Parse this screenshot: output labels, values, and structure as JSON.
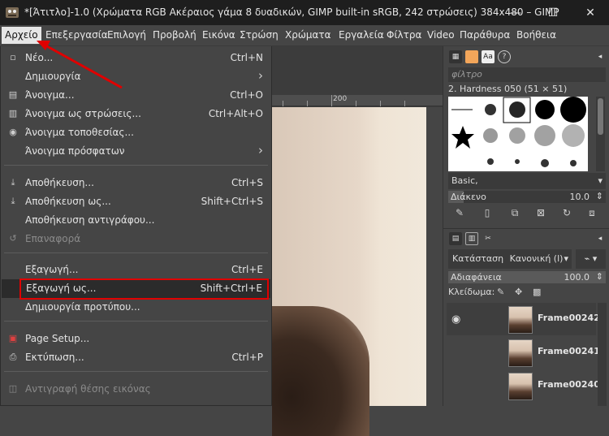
{
  "window": {
    "title": "*[Άτιτλο]-1.0 (Χρώματα RGB Ακέραιος γάμα 8 δυαδικών, GIMP built-in sRGB, 242 στρώσεις) 384x480 – GIMP",
    "minimize_glyph": "—",
    "maximize_glyph": "☐",
    "close_glyph": "✕"
  },
  "menubar": [
    "Αρχείο",
    "Επεξεργασία",
    "Επιλογή",
    "Προβολή",
    "Εικόνα",
    "Στρώση",
    "Χρώματα",
    "Εργαλεία",
    "Φίλτρα",
    "Video",
    "Παράθυρα",
    "Βοήθεια"
  ],
  "file_menu": {
    "items": [
      {
        "label": "Νέο...",
        "shortcut": "Ctrl+N",
        "icon": "new-icon"
      },
      {
        "label": "Δημιουργία",
        "shortcut": "",
        "icon": "",
        "submenu": true
      },
      {
        "label": "Άνοιγμα...",
        "shortcut": "Ctrl+O",
        "icon": "open-icon"
      },
      {
        "label": "Άνοιγμα ως στρώσεις...",
        "shortcut": "Ctrl+Alt+O",
        "icon": "open-as-layers-icon"
      },
      {
        "label": "Άνοιγμα τοποθεσίας...",
        "shortcut": "",
        "icon": "open-location-icon"
      },
      {
        "label": "Άνοιγμα πρόσφατων",
        "shortcut": "",
        "icon": "",
        "submenu": true
      },
      {
        "label": "Αποθήκευση...",
        "shortcut": "Ctrl+S",
        "icon": "save-icon"
      },
      {
        "label": "Αποθήκευση ως...",
        "shortcut": "Shift+Ctrl+S",
        "icon": "save-as-icon"
      },
      {
        "label": "Αποθήκευση αντιγράφου...",
        "shortcut": "",
        "icon": ""
      },
      {
        "label": "Επαναφορά",
        "shortcut": "",
        "icon": "revert-icon",
        "disabled": true
      },
      {
        "label": "Εξαγωγή...",
        "shortcut": "Ctrl+E",
        "icon": ""
      },
      {
        "label": "Εξαγωγή ως...",
        "shortcut": "Shift+Ctrl+E",
        "icon": ""
      },
      {
        "label": "Δημιουργία προτύπου...",
        "shortcut": "",
        "icon": ""
      },
      {
        "label": "Page Setup...",
        "shortcut": "",
        "icon": "page-setup-icon"
      },
      {
        "label": "Εκτύπωση...",
        "shortcut": "Ctrl+P",
        "icon": "print-icon"
      },
      {
        "label": "Αντιγραφή θέσης εικόνας",
        "shortcut": "",
        "icon": "copy-location-icon",
        "disabled": true
      }
    ],
    "submenu_arrow": "›"
  },
  "canvas": {
    "ruler_label": "200"
  },
  "brushes": {
    "filter_placeholder": "φίλτρο",
    "current": "2. Hardness 050 (51 × 51)",
    "preset": "Basic,",
    "spacing_label": "Διάκενο",
    "spacing_value": "10.0",
    "spacing_fraction": 0.1
  },
  "layers": {
    "mode_label": "Κατάσταση",
    "mode_value": "Κανονική (l)",
    "opacity_label": "Αδιαφάνεια",
    "opacity_value": "100.0",
    "opacity_fraction": 1.0,
    "lock_label": "Κλείδωμα:",
    "items": [
      "Frame00242",
      "Frame00241",
      "Frame00240"
    ]
  },
  "highlight_color": "#e00000"
}
